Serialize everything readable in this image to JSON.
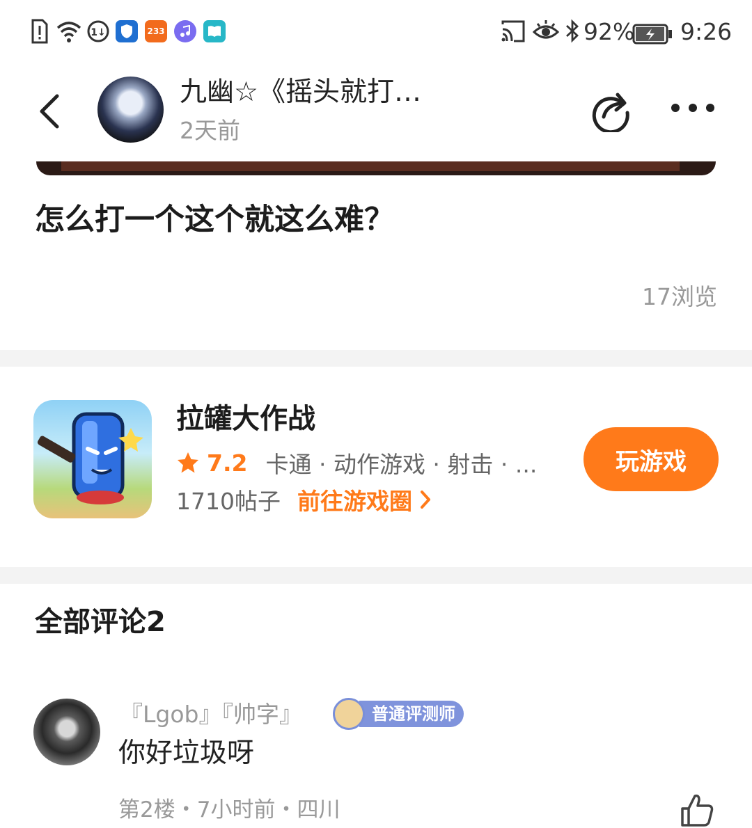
{
  "status_bar": {
    "battery": "92%",
    "time": "9:26",
    "app_233_label": "233"
  },
  "header": {
    "title": "九幽☆《摇头就打…",
    "time_ago": "2天前"
  },
  "post": {
    "title": "怎么打一个这个就这么难？",
    "views": "17浏览"
  },
  "game": {
    "name": "拉罐大作战",
    "rating": "7.2",
    "tags": "卡通 · 动作游戏 · 射击 · ...",
    "posts": "1710帖子",
    "goto_label": "前往游戏圈",
    "play_label": "玩游戏"
  },
  "comments": {
    "header": "全部评论2",
    "items": [
      {
        "user": "『Lgob』『帅字』",
        "badge": "普通评测师",
        "text": "你好垃圾呀",
        "meta": "第2楼・7小时前・四川"
      }
    ]
  },
  "colors": {
    "accent": "#ff7a1a",
    "badge": "#7f93dc",
    "muted_text": "#999999",
    "divider": "#f3f3f3"
  }
}
